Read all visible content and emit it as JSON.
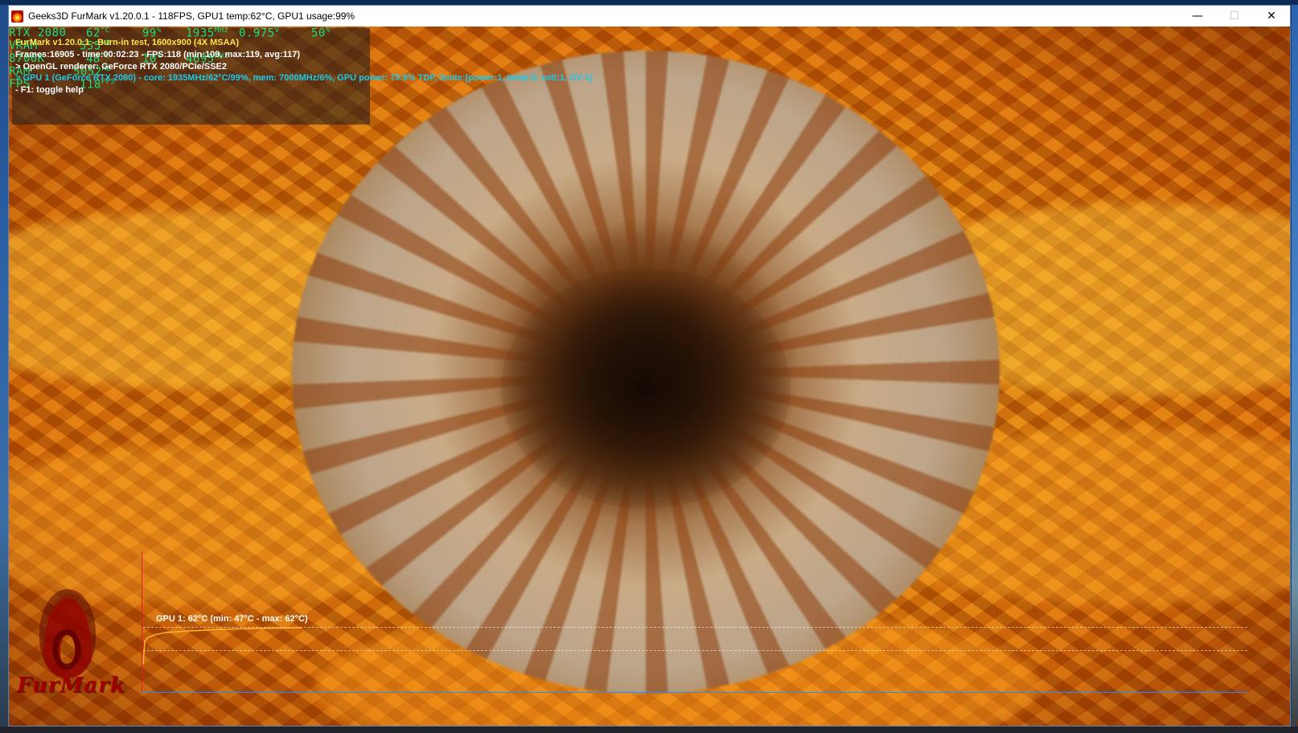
{
  "window": {
    "title": "Geeks3D FurMark v1.20.0.1 - 118FPS, GPU1 temp:62°C, GPU1 usage:99%",
    "minimize": "—",
    "maximize": "☐",
    "close": "✕"
  },
  "hw_monitor": {
    "gpu": {
      "name": "RTX 2080",
      "temp": "62",
      "temp_unit": "°C",
      "usage": "99",
      "usage_unit": "%",
      "clock": "1935",
      "clock_unit": "MHz",
      "voltage": "0.975",
      "voltage_unit": "V",
      "fan": "50",
      "fan_unit": "%"
    },
    "vram": {
      "label": "VRAM",
      "value": "555",
      "unit": "MB"
    },
    "cpu": {
      "name": "8700K",
      "temp": "48",
      "temp_unit": "°C",
      "usage": "10",
      "usage_unit": "%",
      "clock": "4695",
      "clock_unit": "MHz"
    },
    "ram": {
      "label": "RAM",
      "value": "5052",
      "unit": "MB"
    },
    "fps": {
      "label": "FPS",
      "value": "118",
      "unit": "FPS"
    }
  },
  "overlay": {
    "line1": "FurMark v1.20.0.1 - Burn-in test, 1600x900 (4X MSAA)",
    "line2": "Frames:16905 - time:00:02:23 - FPS:118 (min:109, max:119, avg:117)",
    "line3": "> OpenGL renderer: GeForce RTX 2080/PCIe/SSE2",
    "line4": "> GPU 1 (GeForce RTX 2080) - core: 1935MHz/62°C/99%, mem: 7000MHz/6%, GPU power: 79.9% TDP, limits:[power:1, temp:0, volt:1, OV:1]",
    "line5": "- F1: toggle help"
  },
  "graph": {
    "label": "GPU 1: 62°C (min: 47°C - max: 62°C)",
    "colors": {
      "line": "#ffb030",
      "y_axis": "#e02020",
      "x_axis": "#1e90ff"
    },
    "temp_min": 47,
    "temp_max": 62
  },
  "logo": {
    "text": "FurMark"
  }
}
